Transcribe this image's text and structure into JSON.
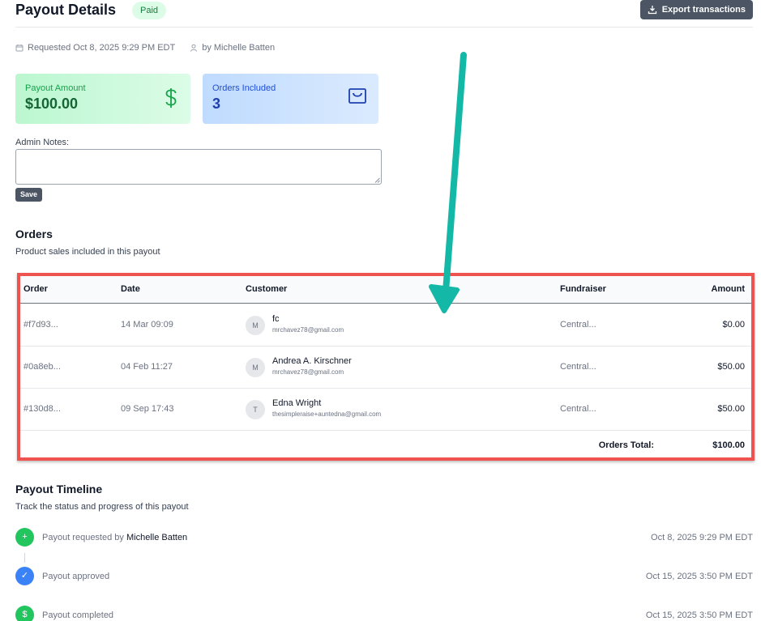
{
  "header": {
    "title": "Payout Details",
    "status_badge": "Paid",
    "export_label": "Export transactions"
  },
  "meta": {
    "requested": "Requested Oct 8, 2025 9:29 PM EDT",
    "by": "by Michelle Batten"
  },
  "stats": {
    "payout_label": "Payout Amount",
    "payout_value": "$100.00",
    "orders_label": "Orders Included",
    "orders_value": "3"
  },
  "notes": {
    "label": "Admin Notes:",
    "value": "",
    "save_label": "Save"
  },
  "orders": {
    "title": "Orders",
    "subtitle": "Product sales included in this payout",
    "columns": [
      "Order",
      "Date",
      "Customer",
      "Fundraiser",
      "Amount"
    ],
    "rows": [
      {
        "order": "#f7d93...",
        "date": "14 Mar 09:09",
        "initial": "M",
        "name": "fc",
        "email": "mrchavez78@gmail.com",
        "fundraiser": "Central...",
        "amount": "$0.00"
      },
      {
        "order": "#0a8eb...",
        "date": "04 Feb 11:27",
        "initial": "M",
        "name": "Andrea A. Kirschner",
        "email": "mrchavez78@gmail.com",
        "fundraiser": "Central...",
        "amount": "$50.00"
      },
      {
        "order": "#130d8...",
        "date": "09 Sep 17:43",
        "initial": "T",
        "name": "Edna Wright",
        "email": "thesimpleraise+auntedna@gmail.com",
        "fundraiser": "Central...",
        "amount": "$50.00"
      }
    ],
    "total_label": "Orders Total:",
    "total_value": "$100.00"
  },
  "timeline": {
    "title": "Payout Timeline",
    "subtitle": "Track the status and progress of this payout",
    "events": [
      {
        "text": "Payout requested by",
        "who": "Michelle Batten",
        "time": "Oct 8, 2025 9:29 PM EDT",
        "color": "#22c55e",
        "glyph": "+"
      },
      {
        "text": "Payout approved",
        "who": "",
        "time": "Oct 15, 2025 3:50 PM EDT",
        "color": "#3b82f6",
        "glyph": "✓"
      },
      {
        "text": "Payout completed",
        "who": "",
        "time": "Oct 15, 2025 3:50 PM EDT",
        "color": "#22c55e",
        "glyph": "$"
      }
    ]
  },
  "colors": {
    "annotation_arrow": "#14b8a6",
    "highlight_border": "#ef5350"
  }
}
